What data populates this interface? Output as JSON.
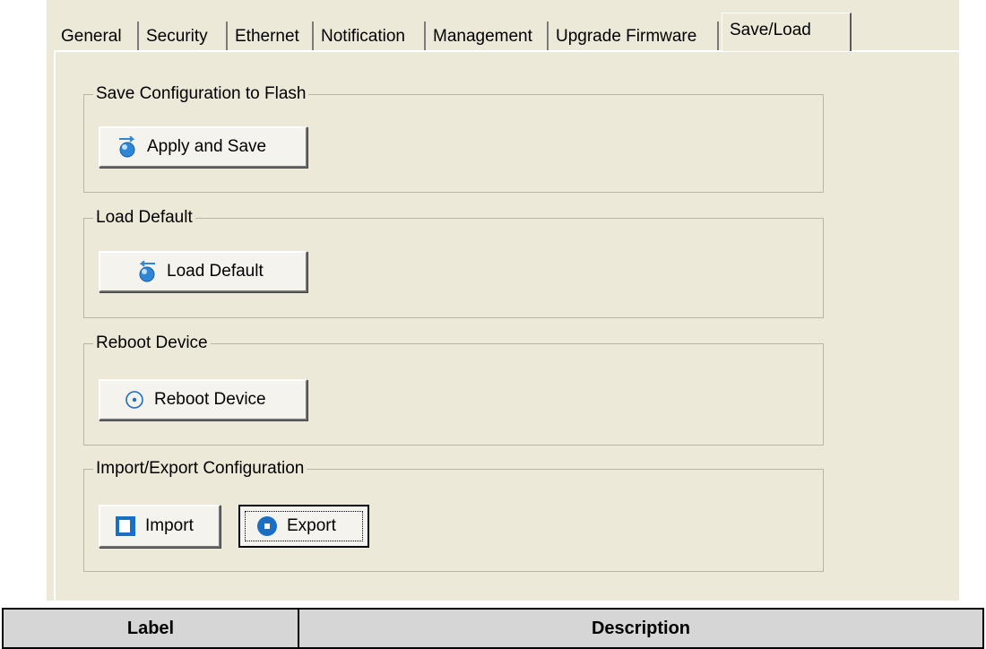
{
  "tabs": [
    {
      "label": "General"
    },
    {
      "label": "Security"
    },
    {
      "label": "Ethernet"
    },
    {
      "label": "Notification"
    },
    {
      "label": "Management"
    },
    {
      "label": "Upgrade Firmware"
    },
    {
      "label": "Save/Load",
      "active": true
    }
  ],
  "groups": {
    "save": {
      "title": "Save Configuration to Flash",
      "button_label": "Apply and Save",
      "button_icon": "apply-save-icon"
    },
    "load": {
      "title": "Load Default",
      "button_label": "Load Default",
      "button_icon": "load-default-icon"
    },
    "reboot": {
      "title": "Reboot Device",
      "button_label": "Reboot Device",
      "button_icon": "reboot-icon"
    },
    "importexport": {
      "title": "Import/Export Configuration",
      "import_label": "Import",
      "import_icon": "import-icon",
      "export_label": "Export",
      "export_icon": "export-icon"
    }
  },
  "table": {
    "headers": [
      "Label",
      "Description"
    ]
  },
  "colors": {
    "dialog_bg": "#ece9d8",
    "icon_blue": "#2f86d6",
    "table_header_bg": "#d6d6d6"
  }
}
